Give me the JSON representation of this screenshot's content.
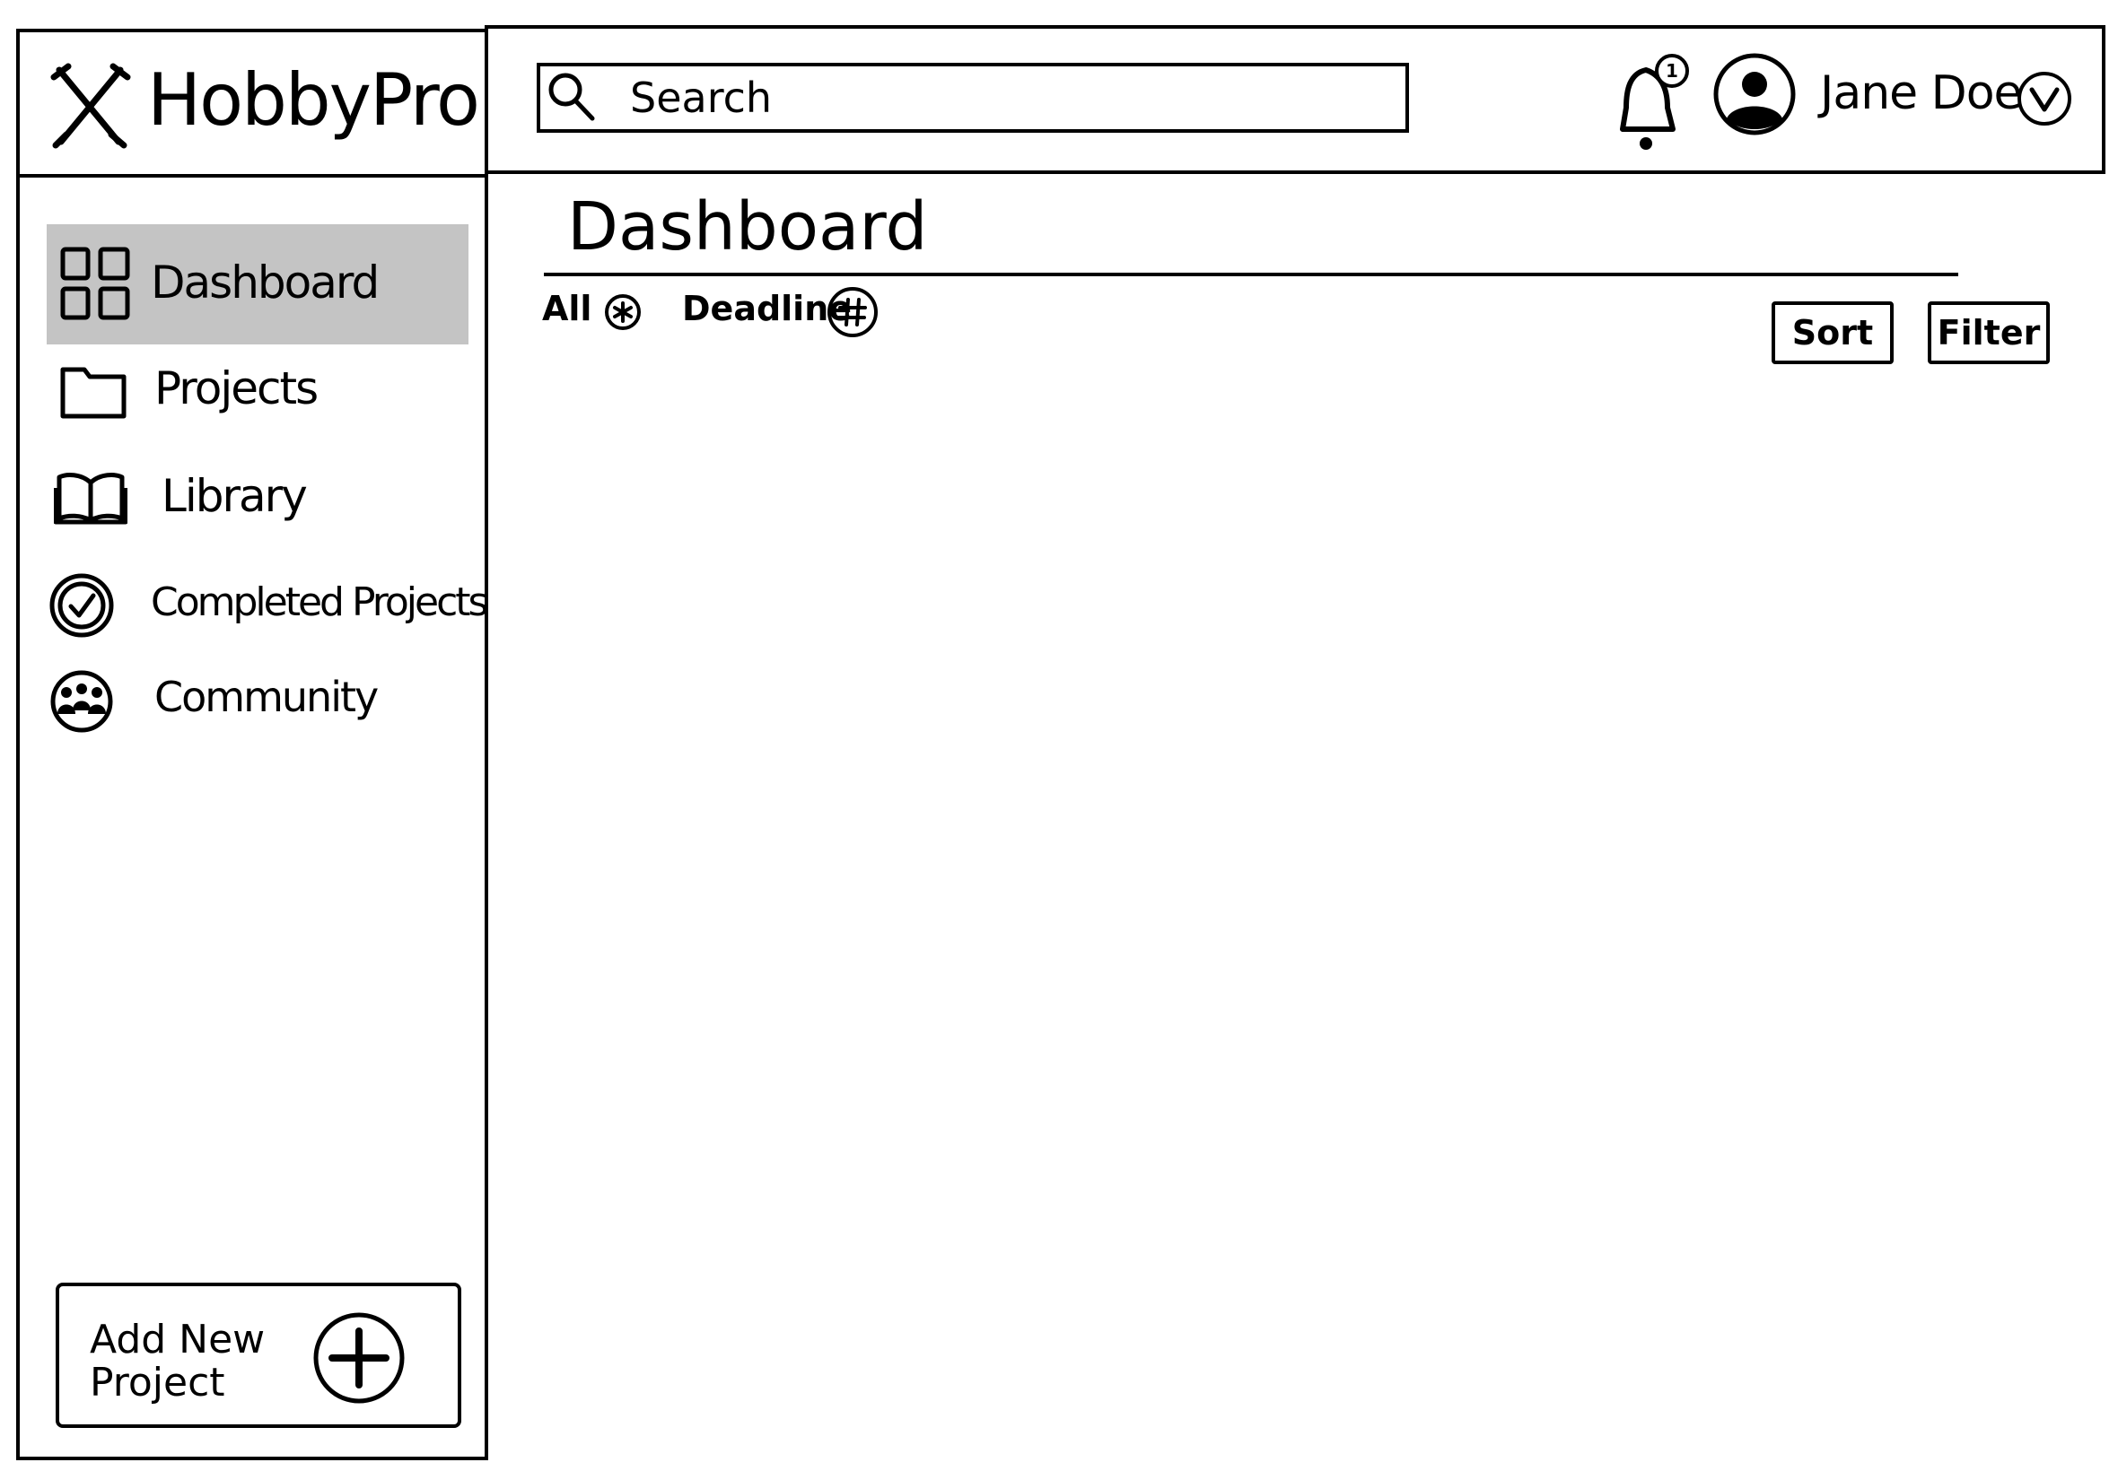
{
  "app": {
    "name": "HobbyPro"
  },
  "search": {
    "placeholder": "Search"
  },
  "notifications": {
    "count": "1"
  },
  "user": {
    "name": "Jane Doe"
  },
  "sidebar": {
    "items": [
      {
        "label": "Dashboard",
        "icon": "grid-icon",
        "active": true
      },
      {
        "label": "Projects",
        "icon": "folder-icon"
      },
      {
        "label": "Library",
        "icon": "book-icon"
      },
      {
        "label": "Completed Projects",
        "icon": "check-circle-icon"
      },
      {
        "label": "Community",
        "icon": "people-icon"
      }
    ],
    "add_button": {
      "label": "Add New Project"
    }
  },
  "main": {
    "title": "Dashboard",
    "filters": [
      {
        "label": "All"
      },
      {
        "label": "Deadline"
      }
    ],
    "sort_label": "Sort",
    "filter_label": "Filter"
  }
}
